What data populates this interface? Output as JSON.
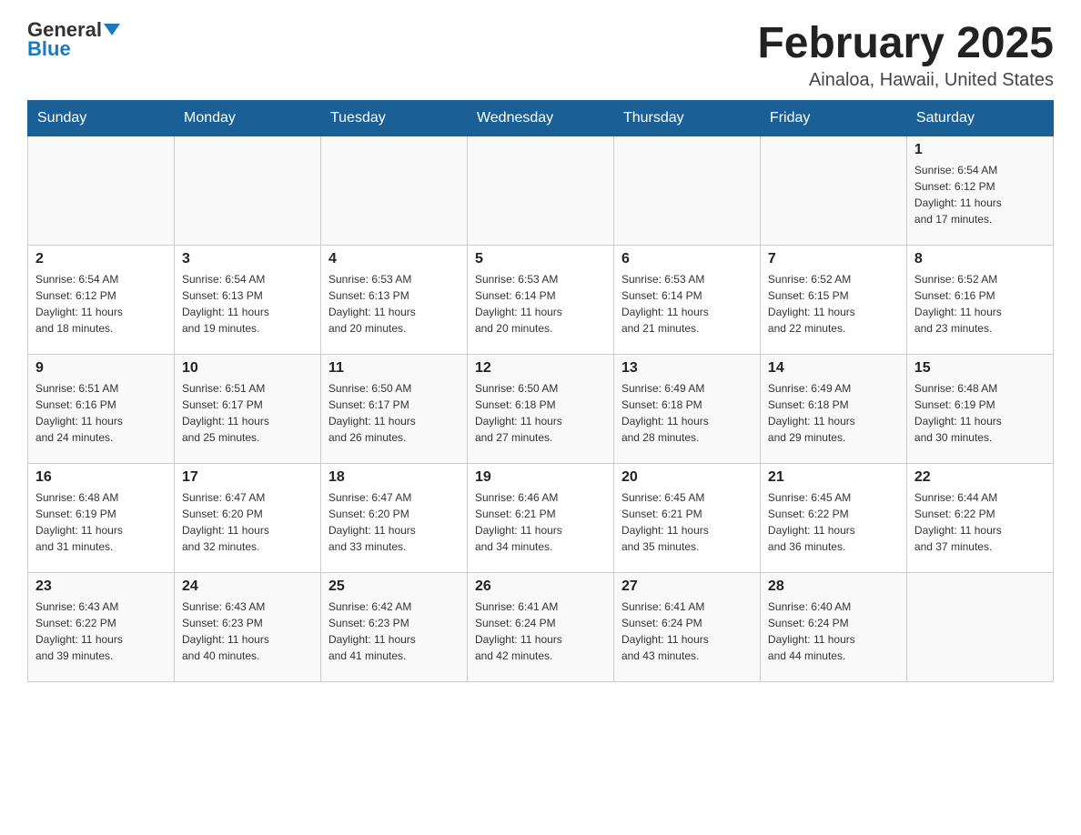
{
  "logo": {
    "general": "General",
    "blue": "Blue"
  },
  "title": "February 2025",
  "location": "Ainaloa, Hawaii, United States",
  "days_of_week": [
    "Sunday",
    "Monday",
    "Tuesday",
    "Wednesday",
    "Thursday",
    "Friday",
    "Saturday"
  ],
  "weeks": [
    [
      {
        "day": "",
        "info": ""
      },
      {
        "day": "",
        "info": ""
      },
      {
        "day": "",
        "info": ""
      },
      {
        "day": "",
        "info": ""
      },
      {
        "day": "",
        "info": ""
      },
      {
        "day": "",
        "info": ""
      },
      {
        "day": "1",
        "info": "Sunrise: 6:54 AM\nSunset: 6:12 PM\nDaylight: 11 hours\nand 17 minutes."
      }
    ],
    [
      {
        "day": "2",
        "info": "Sunrise: 6:54 AM\nSunset: 6:12 PM\nDaylight: 11 hours\nand 18 minutes."
      },
      {
        "day": "3",
        "info": "Sunrise: 6:54 AM\nSunset: 6:13 PM\nDaylight: 11 hours\nand 19 minutes."
      },
      {
        "day": "4",
        "info": "Sunrise: 6:53 AM\nSunset: 6:13 PM\nDaylight: 11 hours\nand 20 minutes."
      },
      {
        "day": "5",
        "info": "Sunrise: 6:53 AM\nSunset: 6:14 PM\nDaylight: 11 hours\nand 20 minutes."
      },
      {
        "day": "6",
        "info": "Sunrise: 6:53 AM\nSunset: 6:14 PM\nDaylight: 11 hours\nand 21 minutes."
      },
      {
        "day": "7",
        "info": "Sunrise: 6:52 AM\nSunset: 6:15 PM\nDaylight: 11 hours\nand 22 minutes."
      },
      {
        "day": "8",
        "info": "Sunrise: 6:52 AM\nSunset: 6:16 PM\nDaylight: 11 hours\nand 23 minutes."
      }
    ],
    [
      {
        "day": "9",
        "info": "Sunrise: 6:51 AM\nSunset: 6:16 PM\nDaylight: 11 hours\nand 24 minutes."
      },
      {
        "day": "10",
        "info": "Sunrise: 6:51 AM\nSunset: 6:17 PM\nDaylight: 11 hours\nand 25 minutes."
      },
      {
        "day": "11",
        "info": "Sunrise: 6:50 AM\nSunset: 6:17 PM\nDaylight: 11 hours\nand 26 minutes."
      },
      {
        "day": "12",
        "info": "Sunrise: 6:50 AM\nSunset: 6:18 PM\nDaylight: 11 hours\nand 27 minutes."
      },
      {
        "day": "13",
        "info": "Sunrise: 6:49 AM\nSunset: 6:18 PM\nDaylight: 11 hours\nand 28 minutes."
      },
      {
        "day": "14",
        "info": "Sunrise: 6:49 AM\nSunset: 6:18 PM\nDaylight: 11 hours\nand 29 minutes."
      },
      {
        "day": "15",
        "info": "Sunrise: 6:48 AM\nSunset: 6:19 PM\nDaylight: 11 hours\nand 30 minutes."
      }
    ],
    [
      {
        "day": "16",
        "info": "Sunrise: 6:48 AM\nSunset: 6:19 PM\nDaylight: 11 hours\nand 31 minutes."
      },
      {
        "day": "17",
        "info": "Sunrise: 6:47 AM\nSunset: 6:20 PM\nDaylight: 11 hours\nand 32 minutes."
      },
      {
        "day": "18",
        "info": "Sunrise: 6:47 AM\nSunset: 6:20 PM\nDaylight: 11 hours\nand 33 minutes."
      },
      {
        "day": "19",
        "info": "Sunrise: 6:46 AM\nSunset: 6:21 PM\nDaylight: 11 hours\nand 34 minutes."
      },
      {
        "day": "20",
        "info": "Sunrise: 6:45 AM\nSunset: 6:21 PM\nDaylight: 11 hours\nand 35 minutes."
      },
      {
        "day": "21",
        "info": "Sunrise: 6:45 AM\nSunset: 6:22 PM\nDaylight: 11 hours\nand 36 minutes."
      },
      {
        "day": "22",
        "info": "Sunrise: 6:44 AM\nSunset: 6:22 PM\nDaylight: 11 hours\nand 37 minutes."
      }
    ],
    [
      {
        "day": "23",
        "info": "Sunrise: 6:43 AM\nSunset: 6:22 PM\nDaylight: 11 hours\nand 39 minutes."
      },
      {
        "day": "24",
        "info": "Sunrise: 6:43 AM\nSunset: 6:23 PM\nDaylight: 11 hours\nand 40 minutes."
      },
      {
        "day": "25",
        "info": "Sunrise: 6:42 AM\nSunset: 6:23 PM\nDaylight: 11 hours\nand 41 minutes."
      },
      {
        "day": "26",
        "info": "Sunrise: 6:41 AM\nSunset: 6:24 PM\nDaylight: 11 hours\nand 42 minutes."
      },
      {
        "day": "27",
        "info": "Sunrise: 6:41 AM\nSunset: 6:24 PM\nDaylight: 11 hours\nand 43 minutes."
      },
      {
        "day": "28",
        "info": "Sunrise: 6:40 AM\nSunset: 6:24 PM\nDaylight: 11 hours\nand 44 minutes."
      },
      {
        "day": "",
        "info": ""
      }
    ]
  ]
}
